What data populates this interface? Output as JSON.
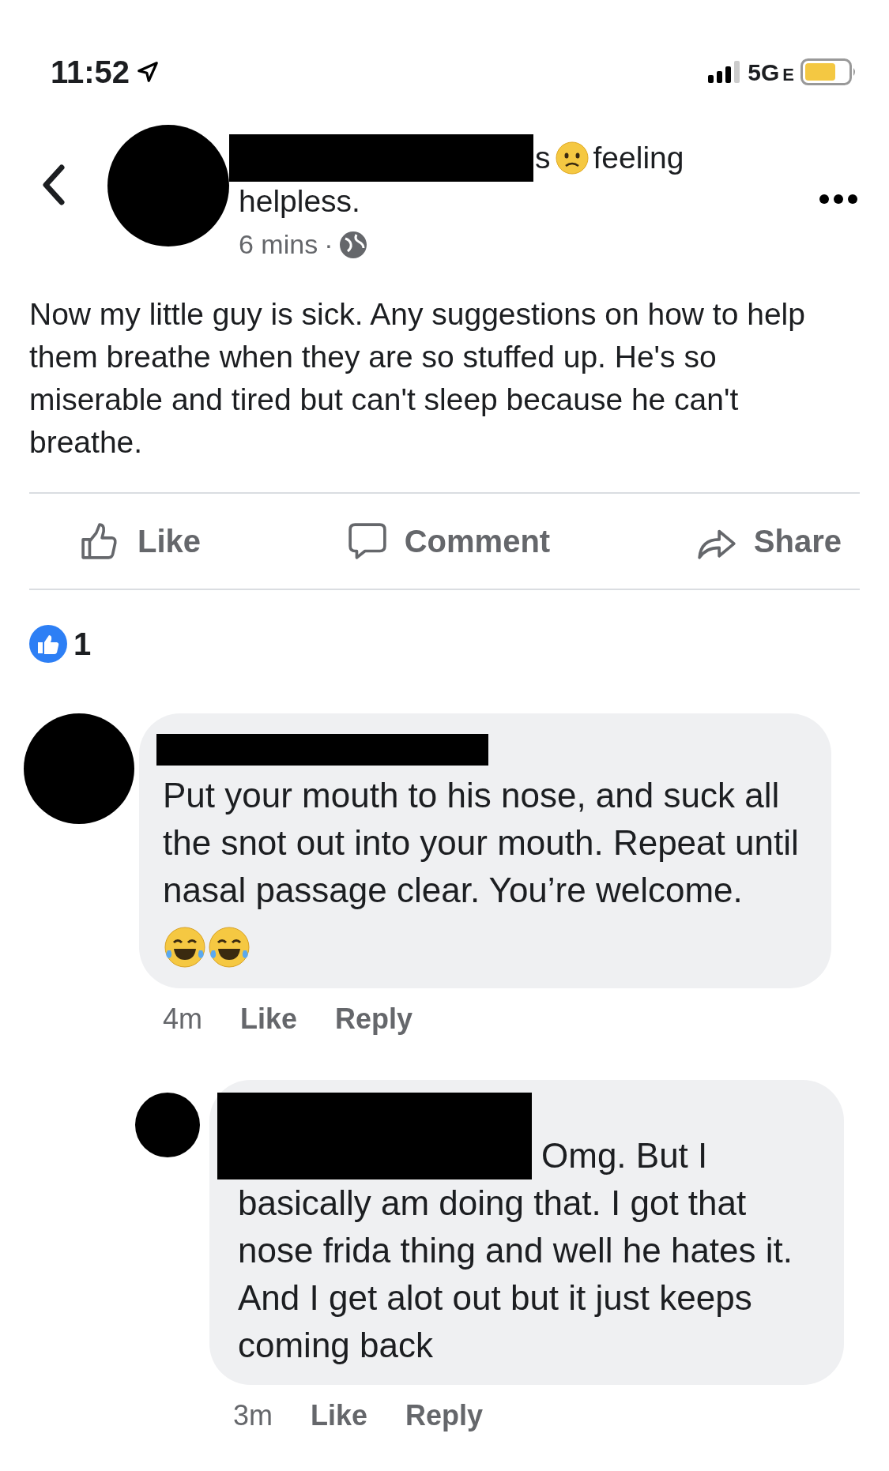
{
  "status_bar": {
    "time": "11:52",
    "network": "5G",
    "network_sub": "E"
  },
  "post": {
    "header_fragment": "s",
    "feeling": "feeling",
    "feeling_rest": "helpless.",
    "time": "6 mins",
    "dot": "·",
    "text": "Now my little guy is sick. Any suggestions on how to help them breathe when they are so stuffed up. He's so miserable and tired but can't sleep because he can't breathe."
  },
  "actions": [
    {
      "kind": "like",
      "label": "Like"
    },
    {
      "kind": "comment",
      "label": "Comment"
    },
    {
      "kind": "share",
      "label": "Share"
    }
  ],
  "reactions": {
    "count": "1"
  },
  "comments": [
    {
      "kind": "comment",
      "text": "Put your mouth to his nose, and suck all the snot out into your mouth. Repeat until nasal passage clear. You’re welcome.",
      "time": "4m",
      "like": "Like",
      "reply": "Reply"
    },
    {
      "kind": "reply",
      "text_first_line": "Omg. But I",
      "text": "basically am doing that. I got that nose frida thing and well he hates it. And I get alot out but it just keeps coming back",
      "time": "3m",
      "like": "Like",
      "reply": "Reply"
    }
  ]
}
